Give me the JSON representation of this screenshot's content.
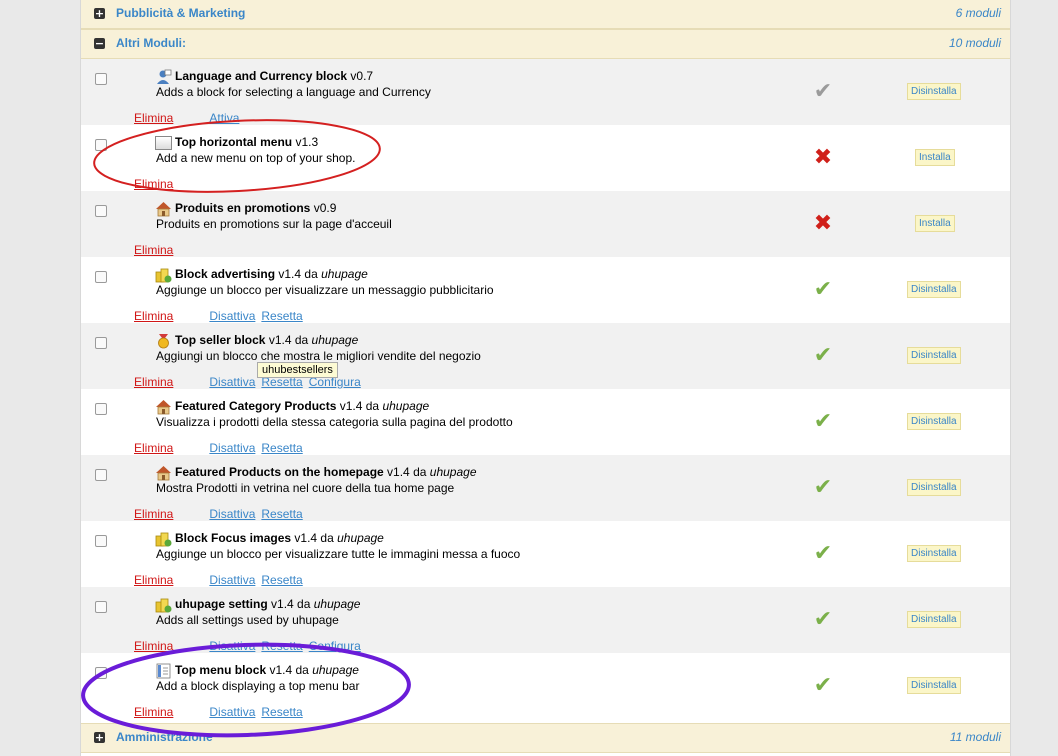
{
  "categories": {
    "top": {
      "name": "Pubblicità & Marketing",
      "count": "6 moduli",
      "toggle": "+"
    },
    "mid": {
      "name": "Altri Moduli:",
      "count": "10 moduli",
      "toggle": "−"
    },
    "bottom": {
      "name": "Amministrazione",
      "count": "11 moduli",
      "toggle": "+"
    }
  },
  "modules": [
    {
      "title": "Language and Currency block",
      "version": "v0.7",
      "author_prefix": "",
      "author": "",
      "desc": "Adds a block for selecting a language and Currency",
      "delete": "Elimina",
      "action1": "Attiva",
      "action2": "",
      "action3": "",
      "status": "✔",
      "button": "Disinstalla",
      "icon": "user-icon"
    },
    {
      "title": "Top horizontal menu",
      "version": "v1.3",
      "author_prefix": "",
      "author": "",
      "desc": "Add a new menu on top of your shop.",
      "delete": "Elimina",
      "action1": "",
      "action2": "",
      "action3": "",
      "status": "✖",
      "button": "Installa",
      "icon": "window-icon"
    },
    {
      "title": "Produits en promotions",
      "version": "v0.9",
      "author_prefix": "",
      "author": "",
      "desc": "Produits en promotions sur la page d'acceuil",
      "delete": "Elimina",
      "action1": "",
      "action2": "",
      "action3": "",
      "status": "✖",
      "button": "Installa",
      "icon": "home-icon"
    },
    {
      "title": "Block advertising",
      "version": "v1.4",
      "author_prefix": "da",
      "author": "uhupage",
      "desc": "Aggiunge un blocco per visualizzare un messaggio pubblicitario",
      "delete": "Elimina",
      "action1": "Disattiva",
      "action2": "Resetta",
      "action3": "",
      "status": "✔",
      "button": "Disinstalla",
      "icon": "coins-icon"
    },
    {
      "title": "Top seller block",
      "version": "v1.4",
      "author_prefix": "da",
      "author": "uhupage",
      "desc": "Aggiungi un blocco che mostra le migliori vendite del negozio",
      "delete": "Elimina",
      "action1": "Disattiva",
      "action2": "Resetta",
      "action3": "Configura",
      "status": "✔",
      "button": "Disinstalla",
      "icon": "medal-icon"
    },
    {
      "title": "Featured Category Products",
      "version": "v1.4",
      "author_prefix": "da",
      "author": "uhupage",
      "desc": "Visualizza i prodotti della stessa categoria sulla pagina del prodotto",
      "delete": "Elimina",
      "action1": "Disattiva",
      "action2": "Resetta",
      "action3": "",
      "status": "✔",
      "button": "Disinstalla",
      "icon": "home-icon"
    },
    {
      "title": "Featured Products on the homepage",
      "version": "v1.4",
      "author_prefix": "da",
      "author": "uhupage",
      "desc": "Mostra Prodotti in vetrina nel cuore della tua home page",
      "delete": "Elimina",
      "action1": "Disattiva",
      "action2": "Resetta",
      "action3": "",
      "status": "✔",
      "button": "Disinstalla",
      "icon": "home-icon"
    },
    {
      "title": "Block Focus images",
      "version": "v1.4",
      "author_prefix": "da",
      "author": "uhupage",
      "desc": "Aggiunge un blocco per visualizzare tutte le immagini messa a fuoco",
      "delete": "Elimina",
      "action1": "Disattiva",
      "action2": "Resetta",
      "action3": "",
      "status": "✔",
      "button": "Disinstalla",
      "icon": "coins-icon"
    },
    {
      "title": "uhupage setting",
      "version": "v1.4",
      "author_prefix": "da",
      "author": "uhupage",
      "desc": "Adds all settings used by uhupage",
      "delete": "Elimina",
      "action1": "Disattiva",
      "action2": "Resetta",
      "action3": "Configura",
      "status": "✔",
      "button": "Disinstalla",
      "icon": "coins-icon"
    },
    {
      "title": "Top menu block",
      "version": "v1.4",
      "author_prefix": "da",
      "author": "uhupage",
      "desc": "Add a block displaying a top menu bar",
      "delete": "Elimina",
      "action1": "Disattiva",
      "action2": "Resetta",
      "action3": "",
      "status": "✔",
      "button": "Disinstalla",
      "icon": "document-icon"
    }
  ],
  "tooltip": "uhubestsellers",
  "colors": {
    "accent": "#3a86c8",
    "delete": "#d01616",
    "ok": "#7bb04a",
    "ko": "#d0201a",
    "annotation_red": "#d42020",
    "annotation_purple": "#6a1cd8"
  }
}
